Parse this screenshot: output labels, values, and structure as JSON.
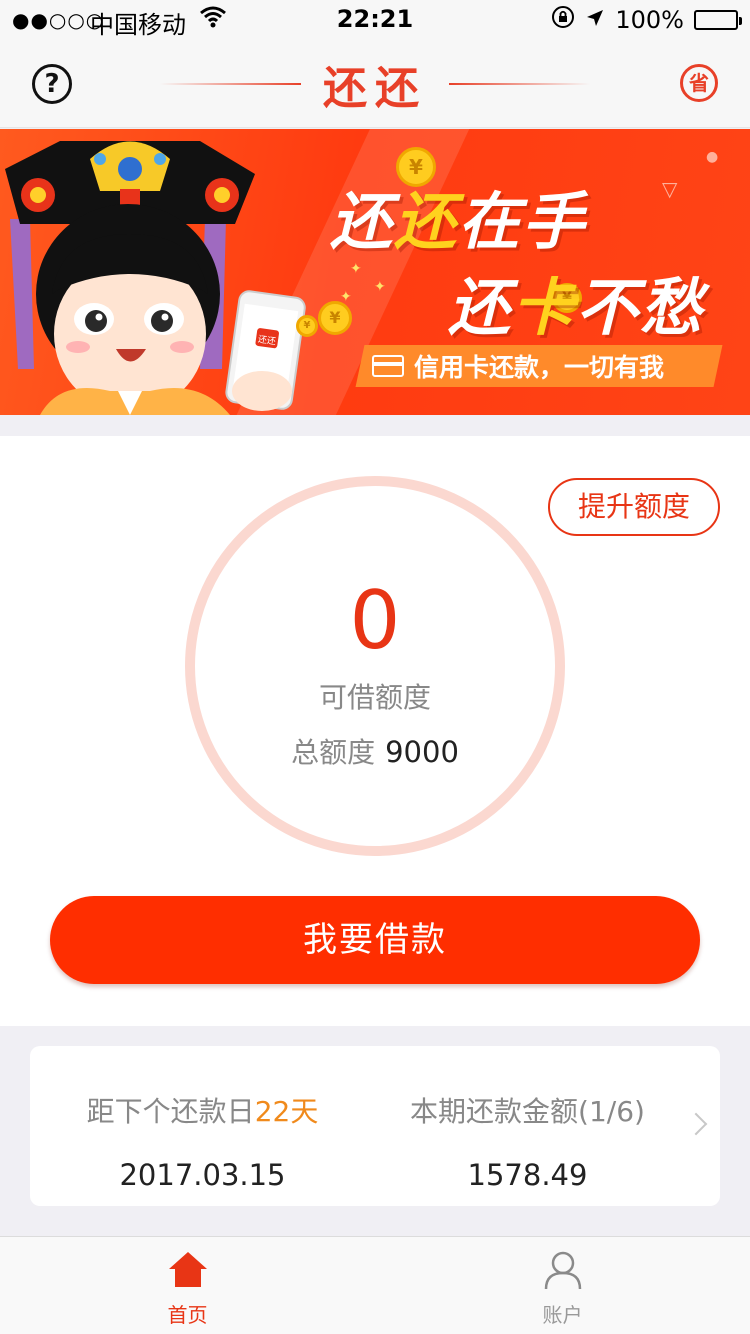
{
  "status_bar": {
    "carrier": "中国移动",
    "time": "22:21",
    "battery": "100%"
  },
  "nav": {
    "title": "还还",
    "help_symbol": "?",
    "save_badge": "省"
  },
  "banner": {
    "line1_a": "还",
    "line1_hl": "还",
    "line1_b": "在手",
    "line2_a": "还",
    "line2_hl": "卡",
    "line2_b": "不愁",
    "tagline": "信用卡还款，一切有我",
    "phone_logo": "还还",
    "coin_symbol": "¥"
  },
  "credit": {
    "raise_button": "提升额度",
    "available_value": "0",
    "available_label": "可借额度",
    "total_label": "总额度",
    "total_value": "9000",
    "borrow_button": "我要借款"
  },
  "repayment": {
    "days_label": "距下个还款日",
    "days_value": "22天",
    "due_date": "2017.03.15",
    "amount_label": "本期还款金额(1/6)",
    "amount_value": "1578.49"
  },
  "tabs": [
    {
      "label": "首页",
      "icon": "home-icon",
      "active": true
    },
    {
      "label": "账户",
      "icon": "person-icon",
      "active": false
    }
  ],
  "colors": {
    "accent": "#e83515",
    "button": "#ff2e00",
    "highlight": "#f08a1c",
    "banner": "#ff3b10"
  }
}
